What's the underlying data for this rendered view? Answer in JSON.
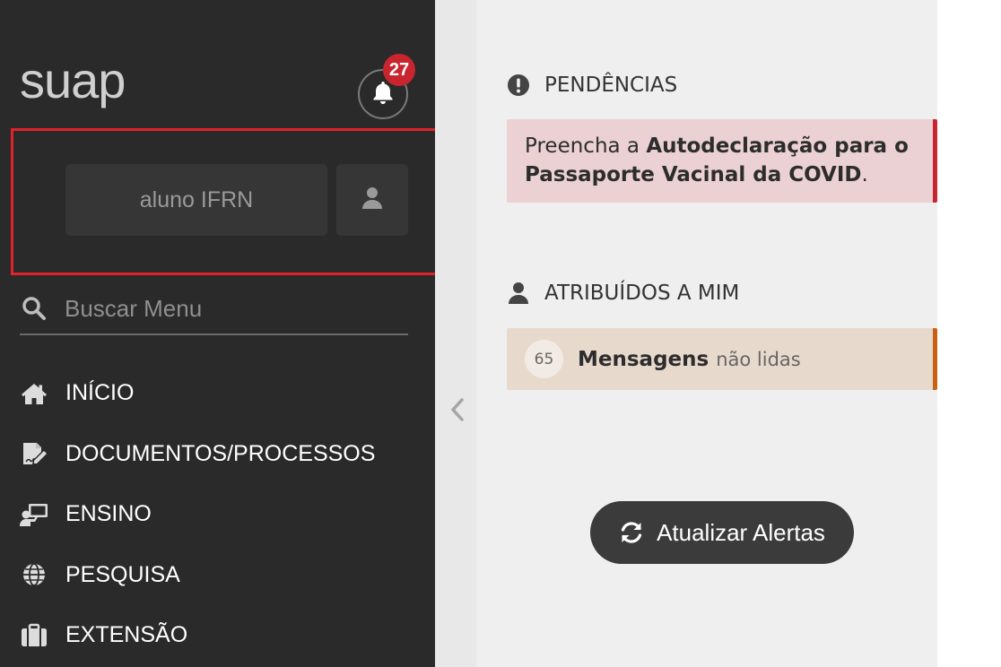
{
  "sidebar": {
    "logo": "suap",
    "notifications_count": "27",
    "user_label": "aluno IFRN",
    "search_placeholder": "Buscar Menu",
    "menu": [
      {
        "label": "INÍCIO",
        "icon": "home-icon"
      },
      {
        "label": "DOCUMENTOS/PROCESSOS",
        "icon": "document-edit-icon"
      },
      {
        "label": "ENSINO",
        "icon": "teacher-board-icon"
      },
      {
        "label": "PESQUISA",
        "icon": "globe-icon"
      },
      {
        "label": "EXTENSÃO",
        "icon": "briefcase-icon"
      }
    ]
  },
  "main": {
    "pendencias": {
      "title": "PENDÊNCIAS",
      "alert_prefix": "Preencha a ",
      "alert_bold": "Autodeclaração para o Passaporte Vacinal da COVID",
      "alert_suffix": "."
    },
    "atribuidos": {
      "title": "ATRIBUÍDOS A MIM",
      "count": "65",
      "bold_text": "Mensagens",
      "light_text": "não lidas"
    },
    "refresh_label": "Atualizar Alertas"
  },
  "colors": {
    "sidebar_bg": "#2a2a2a",
    "badge_red": "#c8252f",
    "pending_border": "#c8252f",
    "message_border": "#c86116"
  }
}
